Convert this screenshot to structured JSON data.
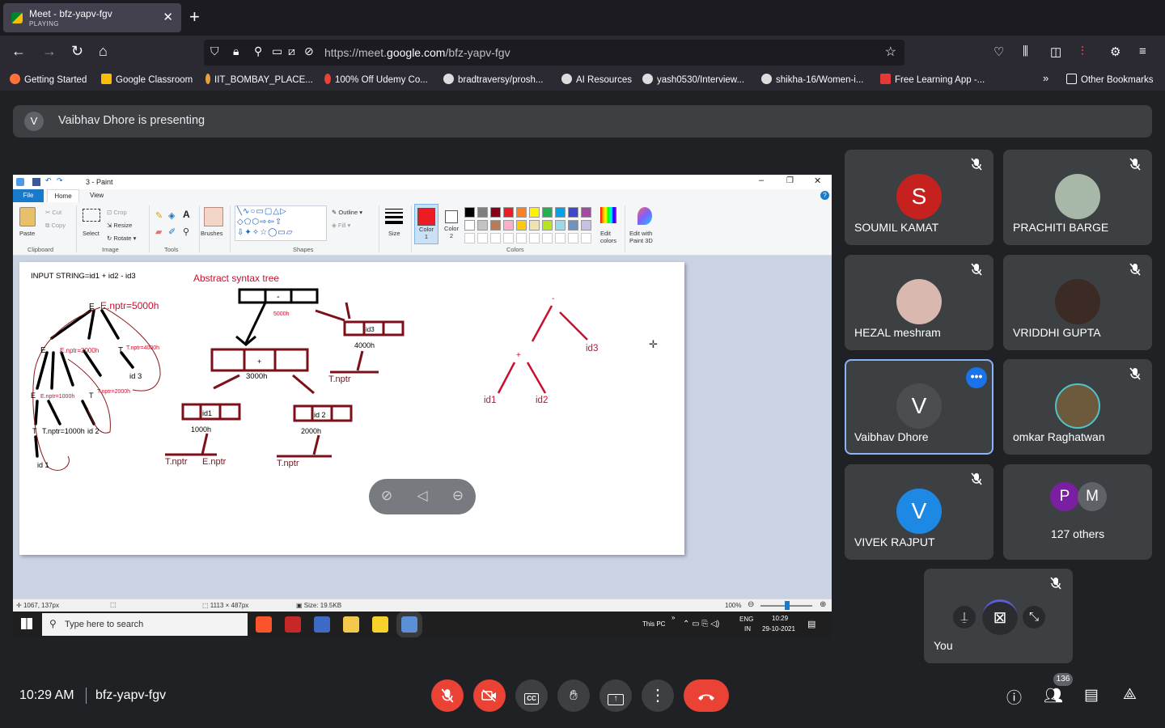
{
  "browser": {
    "tab_title": "Meet - bfz-yapv-fgv",
    "tab_status": "PLAYING",
    "url_prefix": "https://meet.",
    "url_domain": "google.com",
    "url_path": "/bfz-yapv-fgv",
    "bookmarks": [
      "Getting Started",
      "Google Classroom",
      "IIT_BOMBAY_PLACE...",
      "100% Off Udemy Co...",
      "bradtraversy/prosh...",
      "AI Resources",
      "yash0530/Interview...",
      "shikha-16/Women-i...",
      "Free Learning App -..."
    ],
    "other_bookmarks": "Other Bookmarks"
  },
  "presenting_banner": {
    "initial": "V",
    "text": "Vaibhav Dhore is presenting"
  },
  "paint": {
    "title": "3 - Paint",
    "tabs": [
      "File",
      "Home",
      "View"
    ],
    "groups": [
      "Clipboard",
      "Image",
      "Tools",
      "Shapes",
      "Colors"
    ],
    "clipboard": {
      "paste": "Paste",
      "cut": "Cut",
      "copy": "Copy"
    },
    "image": {
      "select": "Select",
      "crop": "Crop",
      "resize": "Resize",
      "rotate": "Rotate"
    },
    "brushes": "Brushes",
    "outline": "Outline",
    "fill": "Fill",
    "size": "Size",
    "color1": [
      "Color",
      "1"
    ],
    "color2": [
      "Color",
      "2"
    ],
    "edit_colors": [
      "Edit",
      "colors"
    ],
    "edit_3d": [
      "Edit with",
      "Paint 3D"
    ],
    "palette_row1": [
      "#000000",
      "#7f7f7f",
      "#880015",
      "#ed1c24",
      "#ff7f27",
      "#fff200",
      "#22b14c",
      "#00a2e8",
      "#3f48cc",
      "#a349a4"
    ],
    "palette_row2": [
      "#ffffff",
      "#c3c3c3",
      "#b97a57",
      "#ffaec9",
      "#ffc90e",
      "#efe4b0",
      "#b5e61d",
      "#99d9ea",
      "#7092be",
      "#c8bfe7"
    ],
    "status": {
      "cursor": "1067, 137px",
      "dims": "1113 × 487px",
      "size": "Size: 19.5KB",
      "zoom": "100%"
    },
    "drawing": {
      "input_string": "INPUT STRING=id1 + id2 - id3",
      "ast_title": "Abstract syntax tree",
      "e_nptr": "E.nptr=5000h",
      "e_nptr_3000": "E.nptr=3000h",
      "t_nptr_4000": "T.nptr=4000h",
      "e_nptr_1000": "E.nptr=1000h",
      "t_nptr_2000": "T.nptr=2000h",
      "t_nptr_1000": "T.nptr=1000h",
      "addr_5000": "5000h",
      "addr_4000": "4000h",
      "addr_3000": "3000h",
      "addr_1000": "1000h",
      "addr_2000": "2000h",
      "minus": "-",
      "plus": "+",
      "id1": "id1",
      "id2": "id2",
      "id3": "id3",
      "id_1": "id 1",
      "id_2": "id 2",
      "id_3": "id 3",
      "id_2b": "id 2",
      "t_nptr": "T.nptr",
      "e_nptr_short": "E.nptr",
      "label_E": "E",
      "label_T": "T"
    }
  },
  "taskbar": {
    "search_placeholder": "Type here to search",
    "this_pc": "This PC",
    "lang1": "ENG",
    "lang2": "IN",
    "time": "10:29",
    "date": "29-10-2021"
  },
  "participants": [
    {
      "name": "SOUMIL KAMAT",
      "initial": "S",
      "color": "#c5221f",
      "photo": false
    },
    {
      "name": "PRACHITI BARGE",
      "initial": "",
      "color": "#a7b8a9",
      "photo": true
    },
    {
      "name": "HEZAL meshram",
      "initial": "",
      "color": "#d9b8b0",
      "photo": true
    },
    {
      "name": "VRIDDHI GUPTA",
      "initial": "",
      "color": "#3b2b24",
      "photo": true
    },
    {
      "name": "Vaibhav Dhore",
      "initial": "V",
      "color": "#4a4e51",
      "photo": false
    },
    {
      "name": "omkar Raghatwan",
      "initial": "",
      "color": "#6d5a3c",
      "photo": true
    },
    {
      "name": "VIVEK RAJPUT",
      "initial": "V",
      "color": "#1e88e5",
      "photo": false
    }
  ],
  "others": {
    "initials": [
      "P",
      "M"
    ],
    "colors": [
      "#7b1fa2",
      "#5f6368"
    ],
    "label": "127 others"
  },
  "self_tile": {
    "name": "You"
  },
  "bottom": {
    "time": "10:29 AM",
    "meeting_code": "bfz-yapv-fgv",
    "participant_count": "136"
  }
}
